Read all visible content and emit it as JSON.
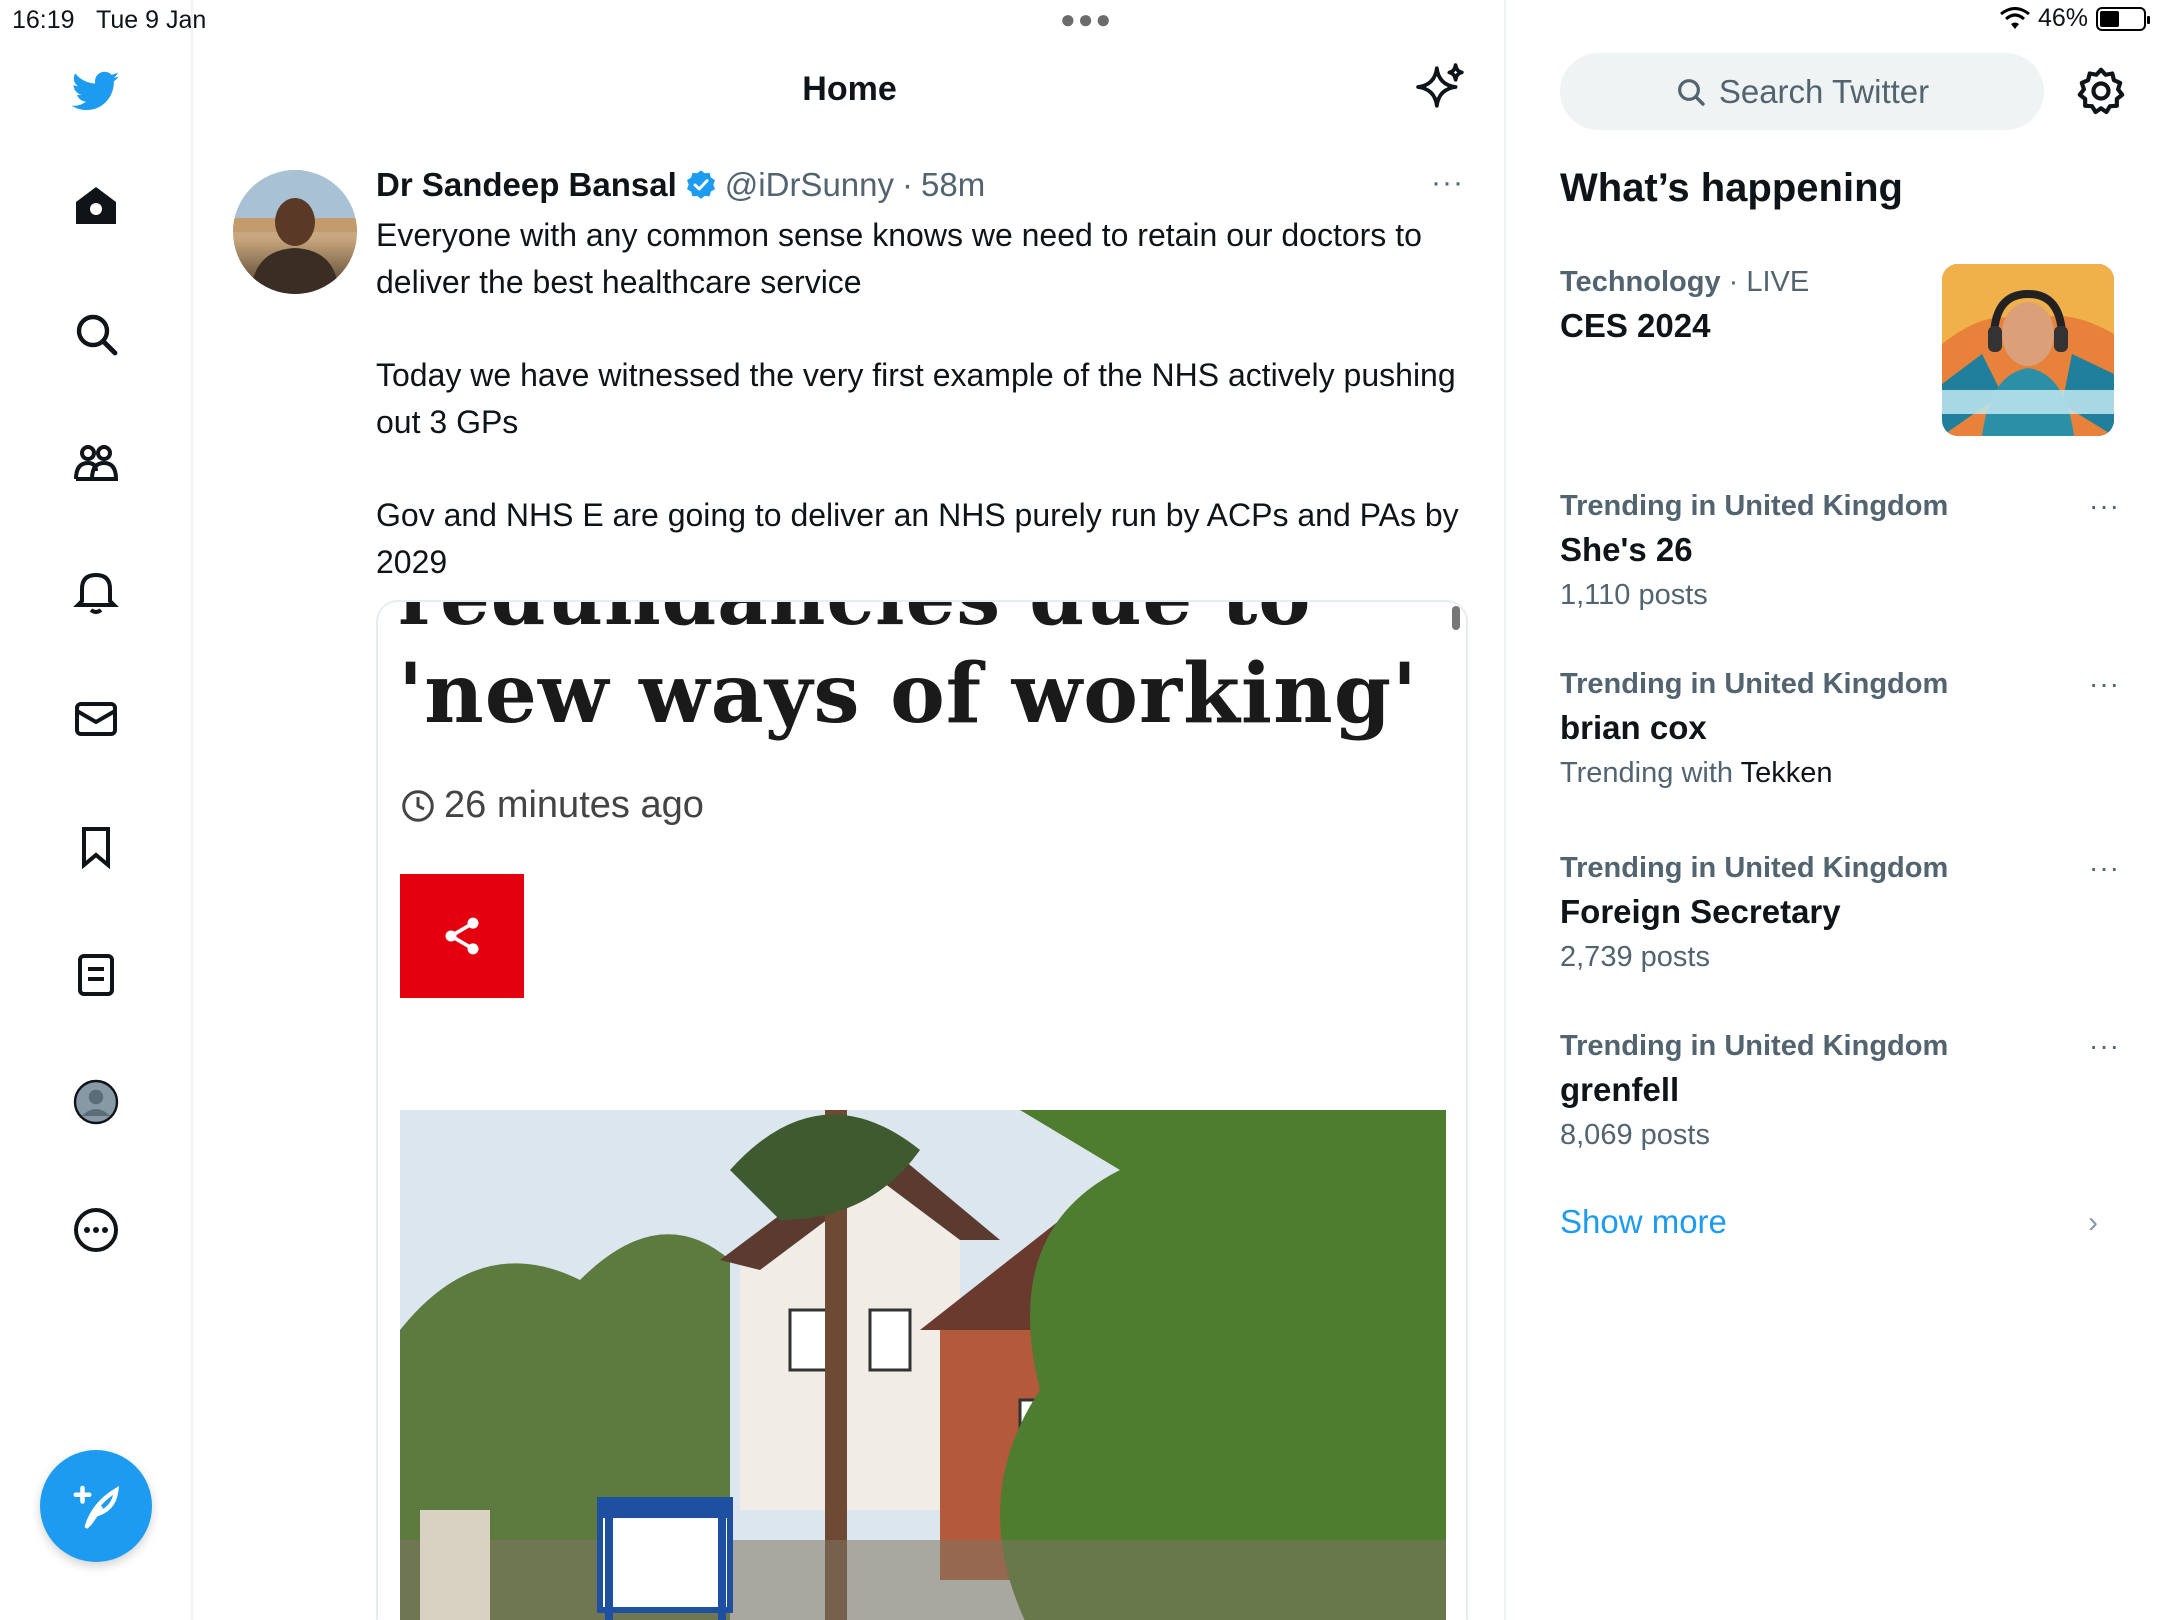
{
  "status_bar": {
    "time": "16:19",
    "date": "Tue 9 Jan",
    "battery": "46%",
    "battery_level": 0.46
  },
  "nav": {
    "items": [
      "twitter-logo",
      "home",
      "search",
      "communities",
      "notifications",
      "messages",
      "bookmarks",
      "lists",
      "profile",
      "more"
    ]
  },
  "header": {
    "title": "Home"
  },
  "tweet": {
    "author_name": "Dr Sandeep Bansal",
    "handle": "@iDrSunny",
    "separator": "·",
    "time": "58m",
    "more": "···",
    "paragraphs": [
      "Everyone with any common sense knows we need to retain our doctors to deliver the best healthcare service",
      "Today we have witnessed the very first example of the NHS actively pushing out 3 GPs",
      "Gov and NHS E are going to deliver an NHS purely run by ACPs and PAs by 2029"
    ],
    "card": {
      "headline_cut": "redundancies due to",
      "headline": "'new ways of working'",
      "time_ago": "26 minutes ago"
    }
  },
  "search": {
    "placeholder": "Search Twitter"
  },
  "sidebar": {
    "title": "What’s happening",
    "featured": {
      "category": "Technology",
      "separator": "·",
      "status": "LIVE",
      "name": "CES 2024"
    },
    "trends": [
      {
        "meta": "Trending in United Kingdom",
        "name": "She's 26",
        "sub": "1,110 posts"
      },
      {
        "meta": "Trending in United Kingdom",
        "name": "brian cox",
        "sub_prefix": "Trending with",
        "sub_link": "Tekken"
      },
      {
        "meta": "Trending in United Kingdom",
        "name": "Foreign Secretary",
        "sub": "2,739 posts"
      },
      {
        "meta": "Trending in United Kingdom",
        "name": "grenfell",
        "sub": "8,069 posts"
      }
    ],
    "more": "···",
    "show_more": "Show more",
    "chevron": "›"
  }
}
